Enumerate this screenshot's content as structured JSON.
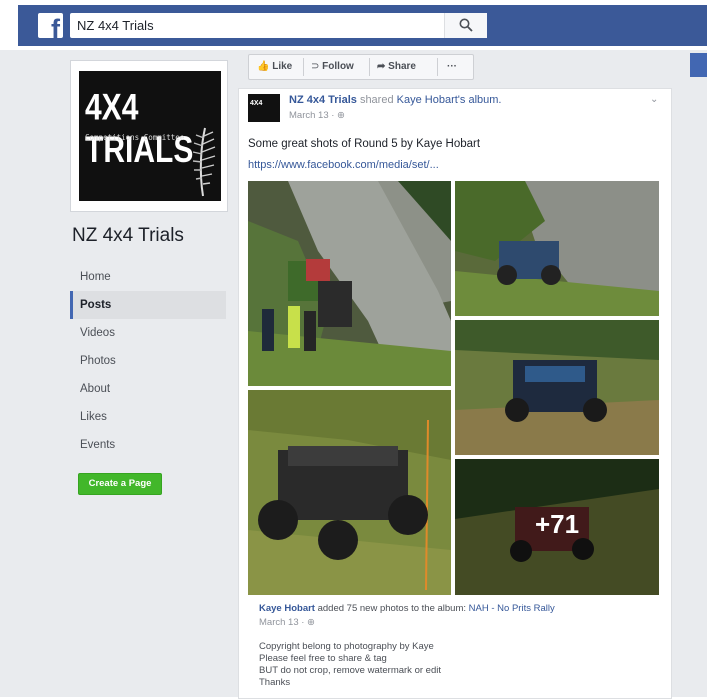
{
  "search": {
    "value": "NZ 4x4 Trials"
  },
  "page": {
    "name": "NZ 4x4 Trials",
    "logo_title": "4X4 TRIALS",
    "logo_subtitle": "Competitions Committee"
  },
  "nav": {
    "items": [
      {
        "label": "Home"
      },
      {
        "label": "Posts"
      },
      {
        "label": "Videos"
      },
      {
        "label": "Photos"
      },
      {
        "label": "About"
      },
      {
        "label": "Likes"
      },
      {
        "label": "Events"
      }
    ],
    "active": "Posts",
    "create_label": "Create a Page"
  },
  "actions": {
    "like": "Like",
    "follow": "Follow",
    "share": "Share",
    "more": "···"
  },
  "post": {
    "page_name": "NZ 4x4 Trials",
    "action_text": "shared",
    "owner": "Kaye Hobart's",
    "album_word": "album.",
    "time": "March 13 · ⊕",
    "text": "Some great shots of Round 5 by Kaye Hobart",
    "link": "https://www.facebook.com/media/set/...",
    "more_photos": "+71",
    "shared_author": "Kaye Hobart",
    "shared_action": "added 75 new photos to the album:",
    "shared_album": "NAH - No Prits Rally",
    "shared_time": "March 13 · ⊕",
    "desc_lines": [
      "Copyright belong to photography by Kaye",
      "Please feel free to share & tag",
      "BUT do not crop, remove watermark or edit",
      "Thanks"
    ]
  },
  "colors": {
    "facebook_blue": "#3b5998",
    "create_green": "#42b72a",
    "link_blue": "#365899"
  }
}
